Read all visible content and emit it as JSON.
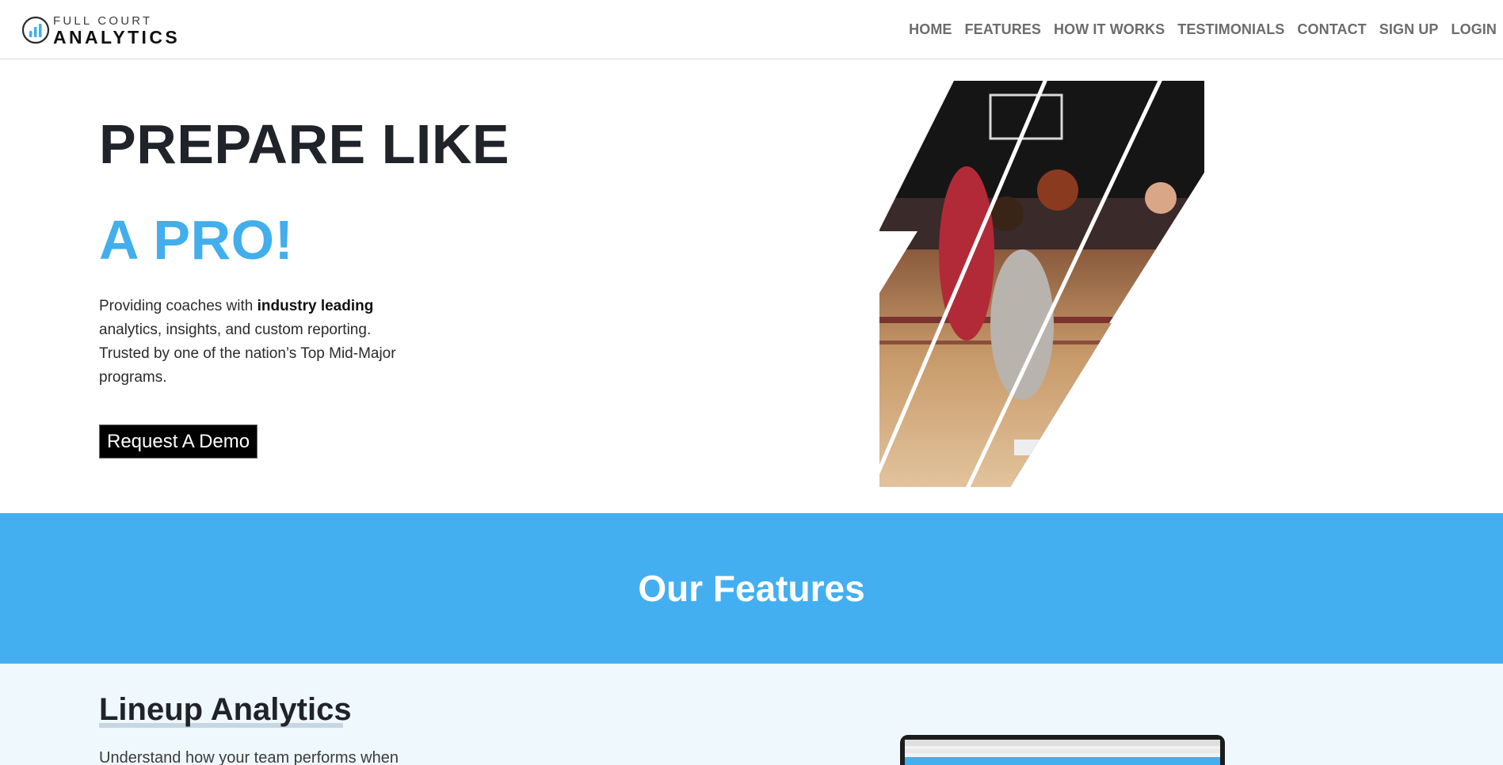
{
  "brand": {
    "top": "FULL COURT",
    "bottom": "ANALYTICS",
    "logo_icon": "bar-chart-circle-icon",
    "accent_color": "#42aeeb"
  },
  "nav": {
    "items": [
      {
        "label": "HOME"
      },
      {
        "label": "FEATURES"
      },
      {
        "label": "HOW IT WORKS"
      },
      {
        "label": "TESTIMONIALS"
      },
      {
        "label": "CONTACT"
      },
      {
        "label": "SIGN UP"
      },
      {
        "label": "LOGIN"
      }
    ]
  },
  "hero": {
    "title": "PREPARE LIKE",
    "accent": "A PRO!",
    "desc_start": "Providing coaches with ",
    "desc_bold": "industry leading",
    "desc_end": " analytics, insights, and custom reporting. Trusted by one of the nation’s Top Mid-Major programs.",
    "cta": "Request A Demo"
  },
  "features": {
    "heading": "Our Features",
    "band_color": "#43aff0",
    "first": {
      "title": "Lineup Analytics",
      "desc": "Understand how your team performs when"
    }
  }
}
